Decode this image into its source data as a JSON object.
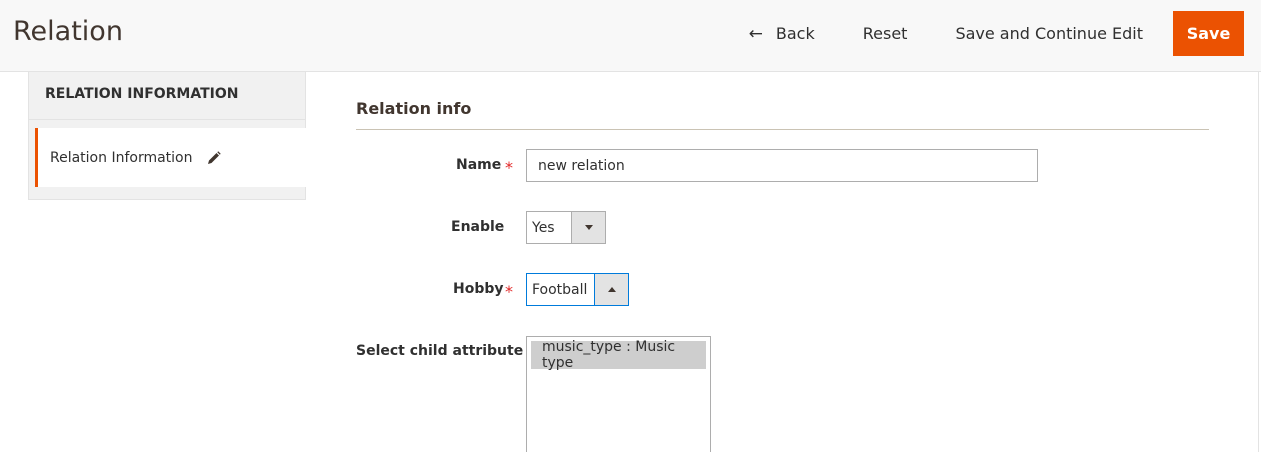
{
  "header": {
    "title": "Relation",
    "back_label": "Back",
    "reset_label": "Reset",
    "save_continue_label": "Save and Continue Edit",
    "save_label": "Save"
  },
  "sidebar": {
    "title": "RELATION INFORMATION",
    "items": [
      {
        "label": "Relation Information",
        "icon": "pencil-icon"
      }
    ]
  },
  "form": {
    "fieldset_title": "Relation info",
    "name": {
      "label": "Name",
      "value": "new relation",
      "required": true
    },
    "enable": {
      "label": "Enable",
      "value": "Yes"
    },
    "hobby": {
      "label": "Hobby",
      "value": "Football",
      "required": true
    },
    "child_attribute": {
      "label": "Select child attribute",
      "options": [
        "music_type : Music type"
      ]
    }
  },
  "colors": {
    "accent": "#eb5202",
    "required": "#e22626",
    "focus": "#007bdb"
  }
}
